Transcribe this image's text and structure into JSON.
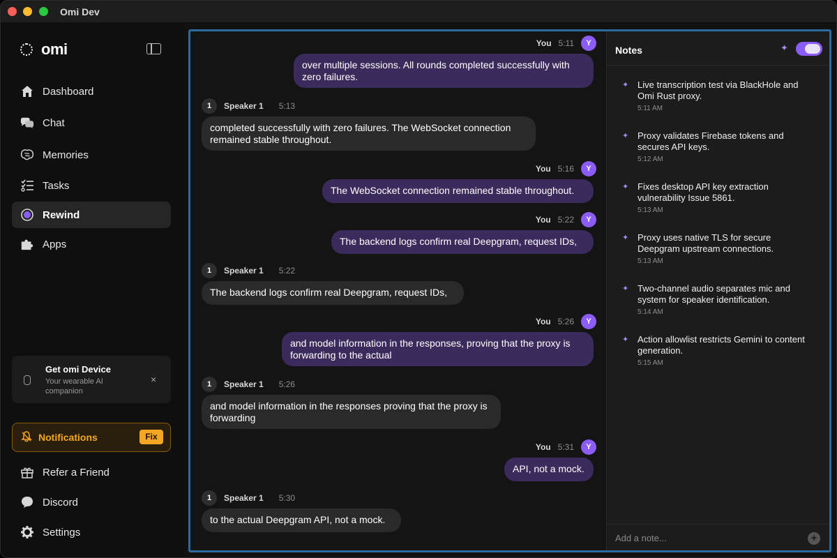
{
  "window": {
    "title": "Omi Dev"
  },
  "sidebar": {
    "logo": "omi",
    "nav": [
      {
        "label": "Dashboard",
        "icon": "home-icon"
      },
      {
        "label": "Chat",
        "icon": "chat-icon"
      },
      {
        "label": "Memories",
        "icon": "brain-icon"
      },
      {
        "label": "Tasks",
        "icon": "tasks-icon"
      },
      {
        "label": "Rewind",
        "icon": "rewind-icon",
        "active": true
      },
      {
        "label": "Apps",
        "icon": "puzzle-icon"
      }
    ],
    "device_card": {
      "title": "Get omi Device",
      "subtitle": "Your wearable AI companion",
      "close": "×"
    },
    "notifications": {
      "label": "Notifications",
      "badge": "Fix"
    },
    "footer_nav": [
      {
        "label": "Refer a Friend",
        "icon": "gift-icon"
      },
      {
        "label": "Discord",
        "icon": "discord-icon"
      },
      {
        "label": "Settings",
        "icon": "gear-icon"
      }
    ]
  },
  "chat": {
    "messages": [
      {
        "speaker": "You",
        "time": "5:11",
        "avatar": "Y",
        "text": "over multiple sessions. All rounds completed successfully with zero failures."
      },
      {
        "speaker": "Speaker 1",
        "time": "5:13",
        "avatar": "1",
        "text": "completed successfully with zero failures. The WebSocket connection remained stable throughout."
      },
      {
        "speaker": "You",
        "time": "5:16",
        "avatar": "Y",
        "text": "The WebSocket connection remained stable throughout."
      },
      {
        "speaker": "You",
        "time": "5:22",
        "avatar": "Y",
        "text": "The backend logs confirm real Deepgram, request IDs,"
      },
      {
        "speaker": "Speaker 1",
        "time": "5:22",
        "avatar": "1",
        "text": "The backend logs confirm real Deepgram, request IDs,"
      },
      {
        "speaker": "You",
        "time": "5:26",
        "avatar": "Y",
        "text": "and model information in the responses, proving that the proxy is forwarding to the actual"
      },
      {
        "speaker": "Speaker 1",
        "time": "5:26",
        "avatar": "1",
        "text": "and model information in the responses proving that the proxy is forwarding"
      },
      {
        "speaker": "You",
        "time": "5:31",
        "avatar": "Y",
        "text": "API, not a mock."
      },
      {
        "speaker": "Speaker 1",
        "time": "5:30",
        "avatar": "1",
        "text": "to the actual Deepgram API, not a mock."
      }
    ]
  },
  "notes": {
    "title": "Notes",
    "toggle_on": true,
    "items": [
      {
        "text": "Live transcription test via BlackHole and Omi Rust proxy.",
        "time": "5:11 AM"
      },
      {
        "text": "Proxy validates Firebase tokens and secures API keys.",
        "time": "5:12 AM"
      },
      {
        "text": "Fixes desktop API key extraction vulnerability Issue 5861.",
        "time": "5:13 AM"
      },
      {
        "text": "Proxy uses native TLS for secure Deepgram upstream connections.",
        "time": "5:13 AM"
      },
      {
        "text": "Two-channel audio separates mic and system for speaker identification.",
        "time": "5:14 AM"
      },
      {
        "text": "Action allowlist restricts Gemini to content generation.",
        "time": "5:15 AM"
      }
    ],
    "input_placeholder": "Add a note...",
    "add_button": "+"
  },
  "colors": {
    "accent": "#8b5cf6",
    "you_bubble": "#3b2a5c",
    "speaker_bubble": "#2a2a2a",
    "warning": "#f5a623",
    "focus_border": "#2c6aa0"
  }
}
